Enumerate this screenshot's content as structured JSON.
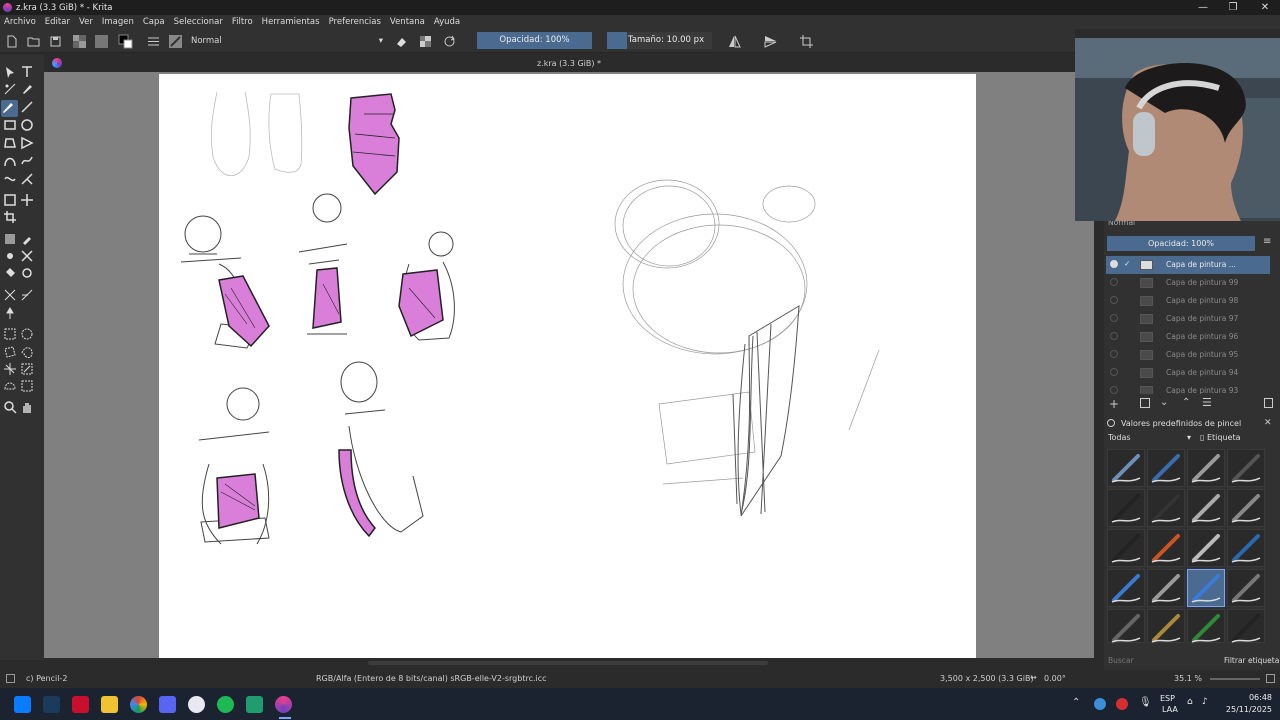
{
  "window": {
    "title": "z.kra (3.3 GiB) * - Krita",
    "minimize": "—",
    "maximize": "❐",
    "close": "✕"
  },
  "menu": [
    "Archivo",
    "Editar",
    "Ver",
    "Imagen",
    "Capa",
    "Seleccionar",
    "Filtro",
    "Herramientas",
    "Preferencias",
    "Ventana",
    "Ayuda"
  ],
  "toolbar": {
    "blend_mode": "Normal",
    "opacity": "Opacidad: 100%",
    "opacity_fraction": 1.0,
    "size": "Tamaño: 10.00 px"
  },
  "document": {
    "tab_title": "z.kra (3.3 GiB) *"
  },
  "layers_panel": {
    "blend_mode": "Normal",
    "opacity": "Opacidad: 100%",
    "layers": [
      "Capa de pintura ...",
      "Capa de pintura 99",
      "Capa de pintura 98",
      "Capa de pintura 97",
      "Capa de pintura 96",
      "Capa de pintura 95",
      "Capa de pintura 94",
      "Capa de pintura 93"
    ]
  },
  "brush_presets": {
    "title": "Valores predefinidos de pincel",
    "filter": "Todas",
    "tag_label": "Etiqueta",
    "search_placeholder": "Buscar",
    "filter_tag": "Filtrar etiqueta"
  },
  "status": {
    "brush": "c) Pencil-2",
    "color_space": "RGB/Alfa (Entero de 8 bits/canal)  sRGB-elle-V2-srgbtrc.icc",
    "dimensions": "3,500 x 2,500 (3.3 GiB)",
    "rotation": "0.00°",
    "zoom": "35.1 %"
  },
  "taskbar": {
    "lang": "ESP",
    "lang2": "LAA",
    "time": "06:48",
    "date": "25/11/2025"
  },
  "colors": {
    "accent": "#4a6a8f",
    "pink": "#d97fd9",
    "panel": "#313131"
  }
}
